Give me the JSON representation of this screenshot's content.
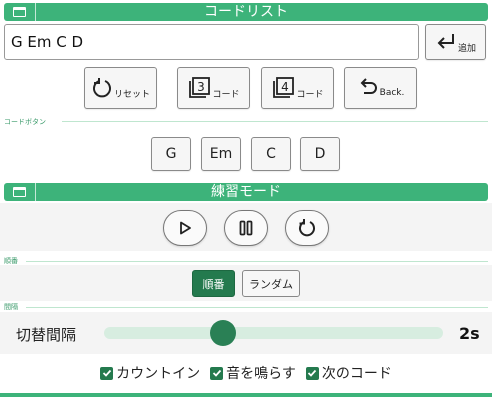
{
  "colors": {
    "accent": "#3db37a",
    "accent_dark": "#247a4e"
  },
  "chord_list": {
    "title": "コードリスト",
    "input_value": "G Em C D",
    "add_label": "追加"
  },
  "tools": {
    "reset_label": "リセット",
    "three_chord_digit": "3",
    "three_chord_label": "コード",
    "four_chord_digit": "4",
    "four_chord_label": "コード",
    "back_label": "Back."
  },
  "chord_buttons": {
    "section_label": "コードボタン",
    "items": [
      "G",
      "Em",
      "C",
      "D"
    ]
  },
  "practice": {
    "title": "練習モード",
    "play_icon": "play-icon",
    "pause_icon": "pause-icon",
    "restart_icon": "restart-icon"
  },
  "order": {
    "section_label": "順番",
    "sequential_label": "順番",
    "random_label": "ランダム",
    "selected": "sequential"
  },
  "interval": {
    "section_label": "間隔",
    "label": "切替間隔",
    "value_text": "2s",
    "fraction": 0.35
  },
  "options": {
    "count_in": {
      "label": "カウントイン",
      "checked": true
    },
    "sound": {
      "label": "音を鳴らす",
      "checked": true
    },
    "next_chord": {
      "label": "次のコード",
      "checked": true
    }
  }
}
